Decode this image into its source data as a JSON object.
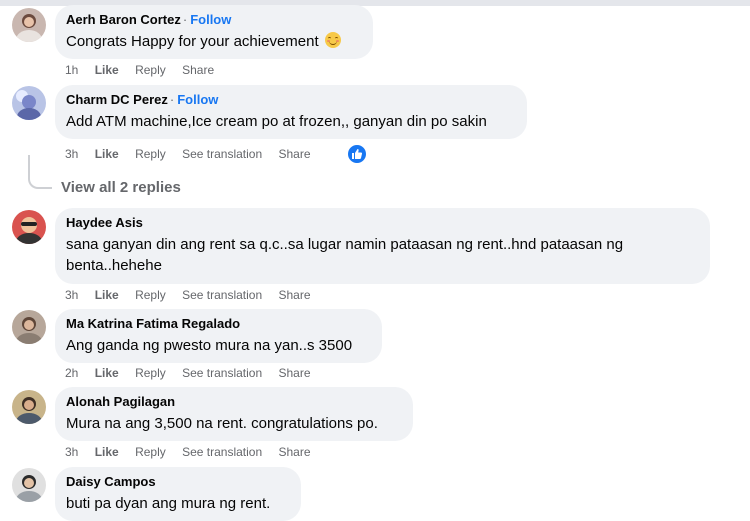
{
  "comments": [
    {
      "name": "Aerh Baron Cortez",
      "follow": "Follow",
      "text": "Congrats Happy for your achievement",
      "emoji": "smiling-face-emoji",
      "time": "1h",
      "like": "Like",
      "reply": "Reply",
      "share": "Share"
    },
    {
      "name": "Charm DC Perez",
      "follow": "Follow",
      "text": "Add ATM machine,Ice cream po at frozen,, ganyan din po sakin",
      "time": "3h",
      "like": "Like",
      "reply": "Reply",
      "translate": "See translation",
      "share": "Share",
      "reaction": "like-icon"
    },
    {
      "name": "Haydee Asis",
      "text_line1": "sana ganyan din ang rent sa q.c..sa lugar namin pataasan ng rent..hnd pataasan ng",
      "text_line2": "benta..hehehe",
      "time": "3h",
      "like": "Like",
      "reply": "Reply",
      "translate": "See translation",
      "share": "Share"
    },
    {
      "name": "Ma Katrina Fatima Regalado",
      "text": "Ang ganda ng pwesto mura na yan..s 3500",
      "time": "2h",
      "like": "Like",
      "reply": "Reply",
      "translate": "See translation",
      "share": "Share"
    },
    {
      "name": "Alonah Pagilagan",
      "text": "Mura na ang 3,500 na rent. congratulations po.",
      "time": "3h",
      "like": "Like",
      "reply": "Reply",
      "translate": "See translation",
      "share": "Share"
    },
    {
      "name": "Daisy Campos",
      "text": "buti pa dyan ang mura ng rent."
    }
  ],
  "view_replies": "View all 2 replies",
  "colors": {
    "accent": "#1877f2",
    "bubble": "#f0f2f5",
    "muted": "#65676b"
  }
}
